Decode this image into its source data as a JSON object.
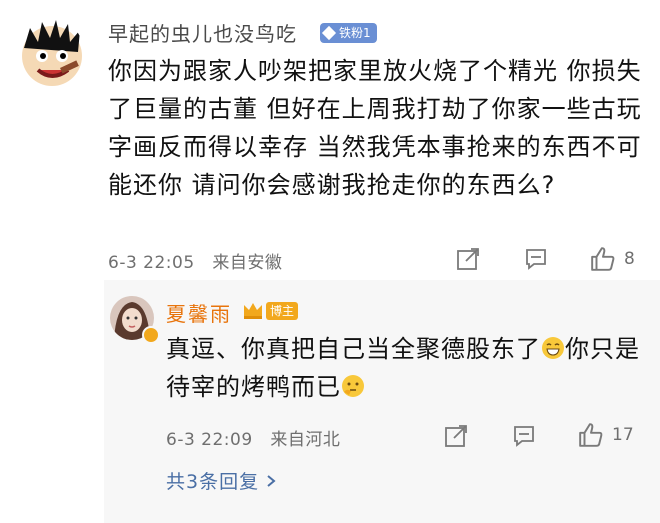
{
  "comment": {
    "username": "早起的虫儿也没鸟吃",
    "fan_badge": "铁粉1",
    "text": "你因为跟家人吵架把家里放火烧了个精光 你损失了巨量的古董  但好在上周我打劫了你家一些古玩字画反而得以幸存  当然我凭本事抢来的东西不可能还你  请问你会感谢我抢走你的东西么?",
    "timestamp": "6-3 22:05",
    "location": "来自安徽",
    "like_count": "8",
    "icons": [
      "share-icon",
      "comment-icon",
      "like-icon"
    ]
  },
  "reply": {
    "username": "夏馨雨",
    "badge": "博主",
    "text_part1": "真逗、你真把自己当全聚德股东了",
    "text_part2": "你只是待宰的烤鸭而已",
    "timestamp": "6-3 22:09",
    "location": "来自河北",
    "like_count": "17",
    "more_replies": "共3条回复",
    "accent_color": "#e8740c"
  },
  "colors": {
    "username": "#4a4a4a",
    "link": "#4a6fa5",
    "badge_blue": "#6a8fd4",
    "badge_gold": "#f2a81d",
    "reply_bg": "#f7f7f7"
  }
}
